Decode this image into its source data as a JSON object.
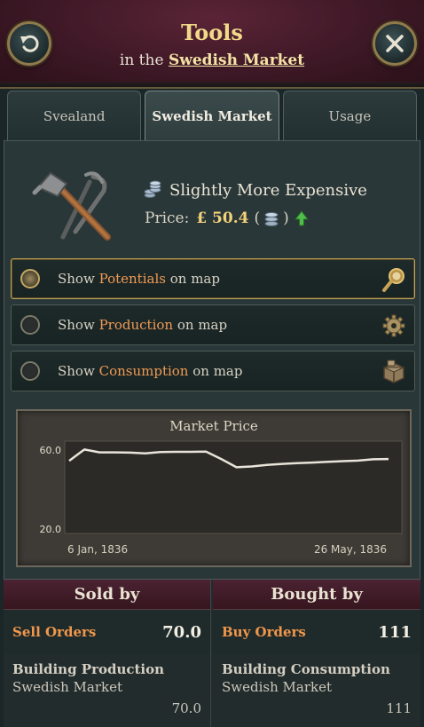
{
  "header": {
    "title": "Tools",
    "subtitle_prefix": "in the",
    "subtitle_link": "Swedish Market",
    "back_icon": "back-arrow-icon",
    "close_icon": "close-icon"
  },
  "tabs": [
    {
      "label": "Svealand",
      "active": false
    },
    {
      "label": "Swedish Market",
      "active": true
    },
    {
      "label": "Usage",
      "active": false
    }
  ],
  "goods": {
    "icon": "hammer-pincers-icon",
    "status": "Slightly More Expensive",
    "price_label": "Price:",
    "price_value": "£ 50.4",
    "trend": "up"
  },
  "map_options": [
    {
      "pre": "Show",
      "highlight": "Potentials",
      "post": "on map",
      "selected": true,
      "icon": "magnifier-icon"
    },
    {
      "pre": "Show",
      "highlight": "Production",
      "post": "on map",
      "selected": false,
      "icon": "gear-icon"
    },
    {
      "pre": "Show",
      "highlight": "Consumption",
      "post": "on map",
      "selected": false,
      "icon": "crate-icon"
    }
  ],
  "chart_data": {
    "type": "line",
    "title": "Market Price",
    "xlabel": "",
    "ylabel": "",
    "x_start_label": "6 Jan, 1836",
    "x_end_label": "26 May, 1836",
    "y_tick_labels": [
      "60.0",
      "20.0"
    ],
    "ylim": [
      20,
      60
    ],
    "series": [
      {
        "values": [
          54.5,
          60.3,
          58.8,
          58.8,
          58.7,
          58.3,
          59.0,
          59.1,
          59.1,
          59.2,
          55.4,
          51.2,
          51.6,
          52.4,
          52.9,
          53.3,
          53.6,
          54.0,
          54.3,
          54.6,
          55.3,
          55.4
        ]
      }
    ],
    "grid": false
  },
  "sold_by": {
    "heading": "Sold by",
    "orders_label": "Sell Orders",
    "orders_value": "70.0",
    "source_name": "Building Production",
    "source_market": "Swedish Market",
    "source_amount": "70.0"
  },
  "bought_by": {
    "heading": "Bought by",
    "orders_label": "Buy Orders",
    "orders_value": "111",
    "source_name": "Building Consumption",
    "source_market": "Swedish Market",
    "source_amount": "111"
  }
}
